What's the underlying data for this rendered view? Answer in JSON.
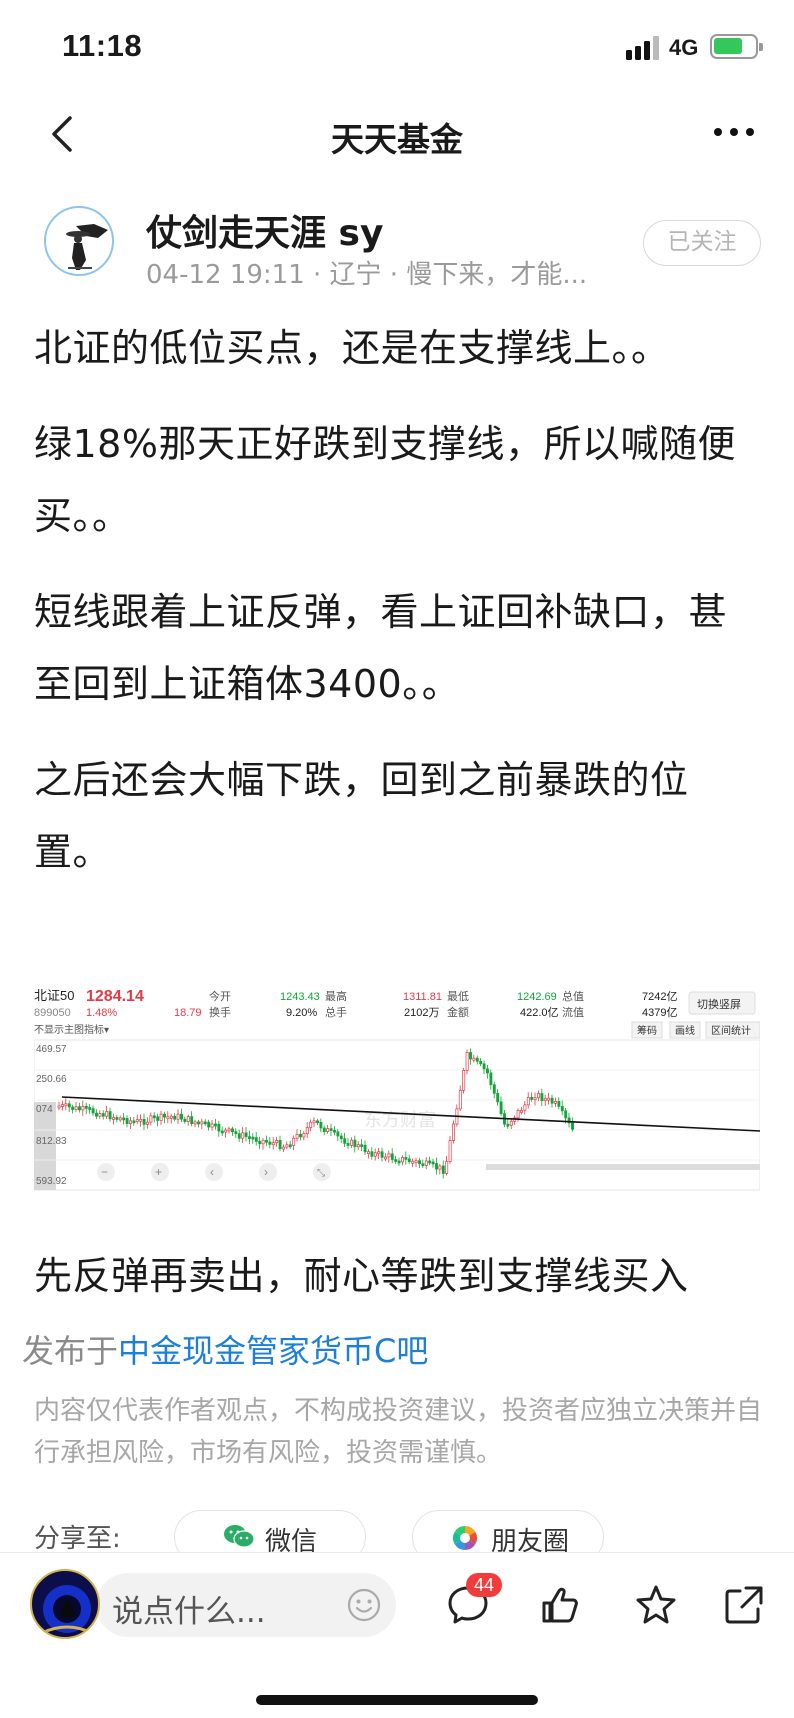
{
  "status_bar": {
    "time": "11:18",
    "network": "4G"
  },
  "nav": {
    "title": "天天基金"
  },
  "author": {
    "name": "仗剑走天涯 sy",
    "meta": "04-12 19:11 · 辽宁 · 慢下来，才能...",
    "follow_label": "已关注"
  },
  "post": {
    "paragraphs": [
      "北证的低位买点，还是在支撑线上。。",
      "绿18%那天正好跌到支撑线，所以喊随便买。。",
      "短线跟着上证反弹，看上证回补缺口，甚至回到上证箱体3400。。",
      "之后还会大幅下跌，回到之前暴跌的位置。"
    ],
    "closing": "先反弹再卖出，耐心等跌到支撑线买入"
  },
  "chart": {
    "name": "北证50",
    "price": "1284.14",
    "code": "899050",
    "change_pct": "1.48%",
    "change_abs": "18.79",
    "open_label": "今开",
    "open": "1243.43",
    "turnover_label": "换手",
    "turnover": "9.20%",
    "high_label": "最高",
    "high": "1311.81",
    "volume_label": "总手",
    "volume": "2102万",
    "low_label": "最低",
    "low": "1242.69",
    "amount_label": "金额",
    "amount": "422.0亿",
    "total_cap_label": "总值",
    "total_cap": "7242亿",
    "float_cap_label": "流值",
    "float_cap": "4379亿",
    "orientation_button": "切换竖屏",
    "indicator_toggle": "不显示主图指标▾",
    "tools": [
      "筹码",
      "画线",
      "区间统计"
    ],
    "y_ticks": [
      "469.57",
      "250.66",
      "074",
      "812.83",
      "593.92"
    ],
    "watermark": "东方财富"
  },
  "footer": {
    "publish_prefix": "发布于",
    "forum": "中金现金管家货币C吧",
    "disclaimer": "内容仅代表作者观点，不构成投资建议，投资者应独立决策并自行承担风险，市场有风险，投资需谨慎。",
    "share_label": "分享至:",
    "share_wechat": "微信",
    "share_moments": "朋友圈"
  },
  "bottom_bar": {
    "comment_placeholder": "说点什么...",
    "comment_count": "44"
  },
  "colors": {
    "up": "#e63946",
    "down": "#13a538",
    "link": "#1e7fd8",
    "badge": "#f23c3c"
  }
}
